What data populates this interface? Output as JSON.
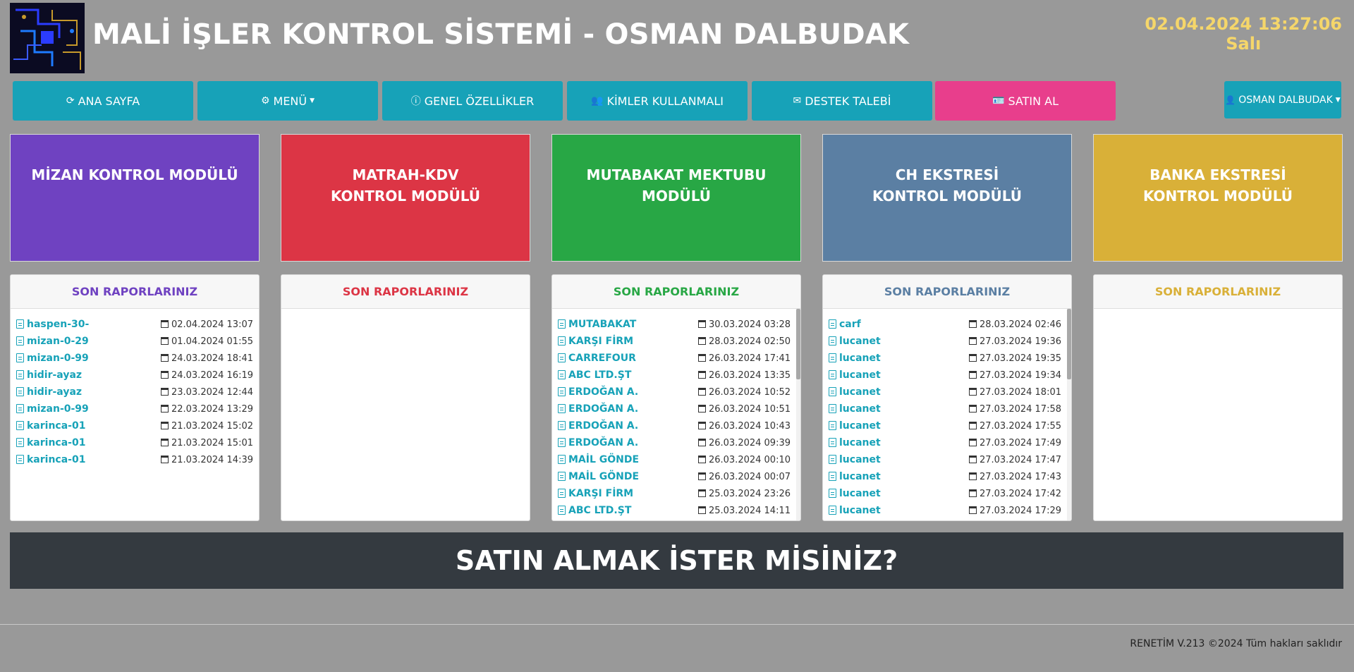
{
  "header": {
    "title": "MALİ İŞLER KONTROL SİSTEMİ - OSMAN DALBUDAK",
    "datetime": "02.04.2024 13:27:06",
    "day": "Salı"
  },
  "nav": {
    "home": "ANA SAYFA",
    "menu": "MENÜ",
    "features": "GENEL ÖZELLİKLER",
    "who": "KİMLER KULLANMALI",
    "support": "DESTEK TALEBİ",
    "buy": "SATIN AL",
    "user": "OSMAN DALBUDAK"
  },
  "icons": {
    "home": "refresh-icon",
    "menu": "cogs-icon",
    "features": "info-circle-icon",
    "who": "users-icon",
    "support": "envelope-icon",
    "buy": "id-card-icon",
    "user": "user-icon"
  },
  "colors": {
    "teal": "#17a2b8",
    "pink": "#e83e8c",
    "purple": "#6f42c1",
    "red": "#dc3545",
    "green": "#28a745",
    "steel": "#5b7fa3",
    "gold": "#d9b038"
  },
  "modules": [
    {
      "line1": "MİZAN KONTROL MODÜLÜ",
      "line2": "",
      "color": "#6f42c1",
      "reports_title": "SON RAPORLARINIZ",
      "reports": [
        {
          "name": "haspen-30-",
          "date": "02.04.2024 13:07"
        },
        {
          "name": "mizan-0-29",
          "date": "01.04.2024 01:55"
        },
        {
          "name": "mizan-0-99",
          "date": "24.03.2024 18:41"
        },
        {
          "name": "hidir-ayaz",
          "date": "24.03.2024 16:19"
        },
        {
          "name": "hidir-ayaz",
          "date": "23.03.2024 12:44"
        },
        {
          "name": "mizan-0-99",
          "date": "22.03.2024 13:29"
        },
        {
          "name": "karinca-01",
          "date": "21.03.2024 15:02"
        },
        {
          "name": "karinca-01",
          "date": "21.03.2024 15:01"
        },
        {
          "name": "karinca-01",
          "date": "21.03.2024 14:39"
        }
      ]
    },
    {
      "line1": "MATRAH-KDV",
      "line2": "KONTROL MODÜLÜ",
      "color": "#dc3545",
      "reports_title": "SON RAPORLARINIZ",
      "reports": []
    },
    {
      "line1": "MUTABAKAT MEKTUBU",
      "line2": "MODÜLÜ",
      "color": "#28a745",
      "reports_title": "SON RAPORLARINIZ",
      "reports": [
        {
          "name": "MUTABAKAT",
          "date": "30.03.2024 03:28"
        },
        {
          "name": "KARŞI FİRM",
          "date": "28.03.2024 02:50"
        },
        {
          "name": "CARREFOUR",
          "date": "26.03.2024 17:41"
        },
        {
          "name": "ABC LTD.ŞT",
          "date": "26.03.2024 13:35"
        },
        {
          "name": "ERDOĞAN A.",
          "date": "26.03.2024 10:52"
        },
        {
          "name": "ERDOĞAN A.",
          "date": "26.03.2024 10:51"
        },
        {
          "name": "ERDOĞAN A.",
          "date": "26.03.2024 10:43"
        },
        {
          "name": "ERDOĞAN A.",
          "date": "26.03.2024 09:39"
        },
        {
          "name": "MAİL GÖNDE",
          "date": "26.03.2024 00:10"
        },
        {
          "name": "MAİL GÖNDE",
          "date": "26.03.2024 00:07"
        },
        {
          "name": "KARŞI FİRM",
          "date": "25.03.2024 23:26"
        },
        {
          "name": "ABC LTD.ŞT",
          "date": "25.03.2024 14:11"
        }
      ]
    },
    {
      "line1": "CH EKSTRESİ",
      "line2": "KONTROL MODÜLÜ",
      "color": "#5b7fa3",
      "reports_title": "SON RAPORLARINIZ",
      "reports": [
        {
          "name": "carf",
          "date": "28.03.2024 02:46"
        },
        {
          "name": "lucanet",
          "date": "27.03.2024 19:36"
        },
        {
          "name": "lucanet",
          "date": "27.03.2024 19:35"
        },
        {
          "name": "lucanet",
          "date": "27.03.2024 19:34"
        },
        {
          "name": "lucanet",
          "date": "27.03.2024 18:01"
        },
        {
          "name": "lucanet",
          "date": "27.03.2024 17:58"
        },
        {
          "name": "lucanet",
          "date": "27.03.2024 17:55"
        },
        {
          "name": "lucanet",
          "date": "27.03.2024 17:49"
        },
        {
          "name": "lucanet",
          "date": "27.03.2024 17:47"
        },
        {
          "name": "lucanet",
          "date": "27.03.2024 17:43"
        },
        {
          "name": "lucanet",
          "date": "27.03.2024 17:42"
        },
        {
          "name": "lucanet",
          "date": "27.03.2024 17:29"
        }
      ]
    },
    {
      "line1": "BANKA EKSTRESİ",
      "line2": "KONTROL MODÜLÜ",
      "color": "#d9b038",
      "reports_title": "SON RAPORLARINIZ",
      "reports": []
    }
  ],
  "banner": "SATIN ALMAK İSTER MİSİNİZ?",
  "footer": "RENETİM V.213 ©2024 Tüm hakları saklıdır"
}
